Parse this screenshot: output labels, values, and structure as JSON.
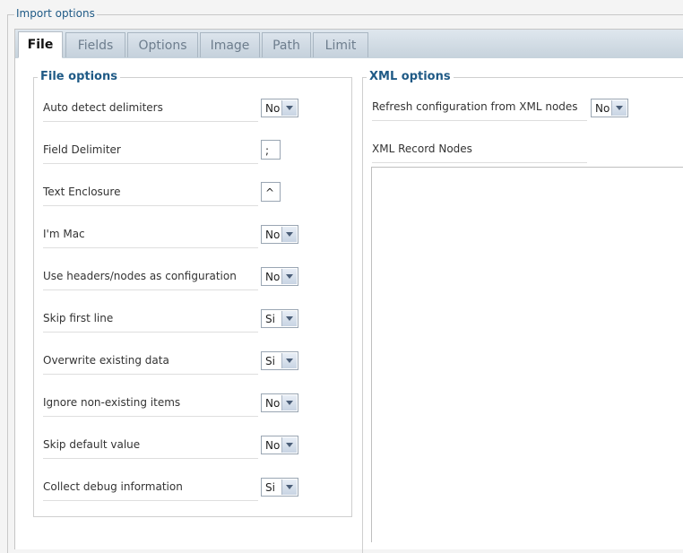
{
  "outer": {
    "legend": "Import options"
  },
  "tabs": [
    {
      "label": "File",
      "active": true
    },
    {
      "label": "Fields"
    },
    {
      "label": "Options"
    },
    {
      "label": "Image"
    },
    {
      "label": "Path"
    },
    {
      "label": "Limit"
    }
  ],
  "file_options": {
    "legend": "File options",
    "rows": [
      {
        "label": "Auto detect delimiters",
        "control": "select",
        "value": "No"
      },
      {
        "label": "Field Delimiter",
        "control": "text",
        "value": ";"
      },
      {
        "label": "Text Enclosure",
        "control": "text",
        "value": "^"
      },
      {
        "label": "I'm Mac",
        "control": "select",
        "value": "No"
      },
      {
        "label": "Use headers/nodes as configuration",
        "control": "select",
        "value": "No"
      },
      {
        "label": "Skip first line",
        "control": "select",
        "value": "Si"
      },
      {
        "label": "Overwrite existing data",
        "control": "select",
        "value": "Si"
      },
      {
        "label": "Ignore non-existing items",
        "control": "select",
        "value": "No"
      },
      {
        "label": "Skip default value",
        "control": "select",
        "value": "No"
      },
      {
        "label": "Collect debug information",
        "control": "select",
        "value": "Si"
      }
    ]
  },
  "xml_options": {
    "legend": "XML options",
    "refresh_label": "Refresh configuration from XML nodes",
    "refresh_value": "No",
    "record_nodes_label": "XML Record Nodes",
    "record_nodes_value": ""
  }
}
